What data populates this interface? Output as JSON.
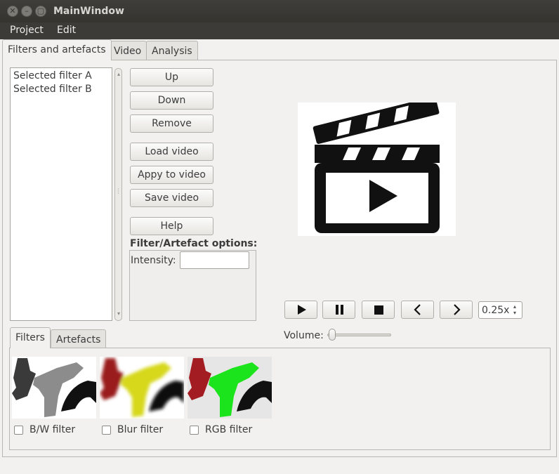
{
  "window": {
    "title": "MainWindow",
    "buttons": [
      "close-icon",
      "minimize-icon",
      "maximize-icon"
    ]
  },
  "menu": {
    "project": "Project",
    "edit": "Edit"
  },
  "tabs": {
    "filters_artefacts": "Filters and artefacts",
    "video": "Video",
    "analysis": "Analysis",
    "active": "Filters and artefacts"
  },
  "selected_filters": [
    "Selected filter A",
    "Selected filter B"
  ],
  "buttons": {
    "up": "Up",
    "down": "Down",
    "remove": "Remove",
    "load_video": "Load video",
    "apply_video": "Appy to video",
    "save_video": "Save video",
    "help": "Help"
  },
  "options": {
    "title": "Filter/Artefact options:",
    "intensity_label": "Intensity:",
    "intensity_value": ""
  },
  "player": {
    "preview_icon": "clapperboard-play-icon",
    "controls": [
      "play-icon",
      "pause-icon",
      "stop-icon",
      "previous-icon",
      "next-icon"
    ],
    "speed": "0.25x",
    "volume_label": "Volume:",
    "volume_level": 0.0
  },
  "bottom_tabs": {
    "filters": "Filters",
    "artefacts": "Artefacts",
    "active": "Filters"
  },
  "filter_items": [
    {
      "label": "B/W filter",
      "checked": false,
      "colors": [
        "#3a3a3a",
        "#8c8c8c",
        "#111111"
      ]
    },
    {
      "label": "Blur filter",
      "checked": false,
      "colors": [
        "#9a1c1c",
        "#d7d81a",
        "#111111"
      ]
    },
    {
      "label": "RGB filter",
      "checked": false,
      "colors": [
        "#a31c22",
        "#1ce41c",
        "#111111"
      ]
    }
  ],
  "colors": {
    "titlebar": "#3c3b37",
    "window_bg": "#f2f1f0"
  }
}
